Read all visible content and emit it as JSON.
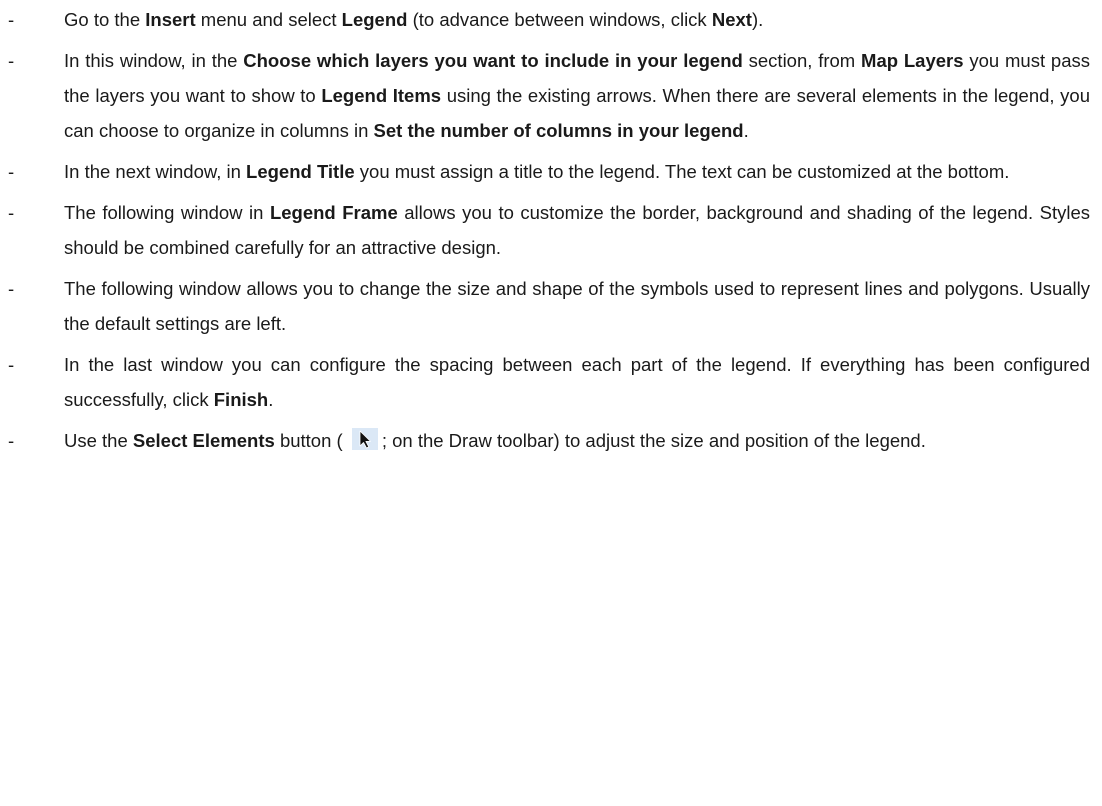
{
  "bullet_glyph": "-",
  "items": [
    {
      "segments": [
        {
          "text": "Go to the ",
          "bold": false
        },
        {
          "text": "Insert",
          "bold": true
        },
        {
          "text": " menu and select ",
          "bold": false
        },
        {
          "text": "Legend",
          "bold": true
        },
        {
          "text": " (to advance between windows, click ",
          "bold": false
        },
        {
          "text": "Next",
          "bold": true
        },
        {
          "text": ").",
          "bold": false
        }
      ]
    },
    {
      "segments": [
        {
          "text": "In this window, in the ",
          "bold": false
        },
        {
          "text": "Choose which layers you want to include in your legend",
          "bold": true
        },
        {
          "text": " section, from ",
          "bold": false
        },
        {
          "text": "Map Layers",
          "bold": true
        },
        {
          "text": " you must pass the layers you want to show to ",
          "bold": false
        },
        {
          "text": "Legend Items",
          "bold": true
        },
        {
          "text": " using the existing arrows. When there are several elements in the legend, you can choose to organize in columns in ",
          "bold": false
        },
        {
          "text": "Set the number of columns in your legend",
          "bold": true
        },
        {
          "text": ".",
          "bold": false
        }
      ]
    },
    {
      "segments": [
        {
          "text": "In the next window, in ",
          "bold": false
        },
        {
          "text": "Legend Title",
          "bold": true
        },
        {
          "text": " you must assign a title to the legend. The text can be customized at the bottom.",
          "bold": false
        }
      ]
    },
    {
      "segments": [
        {
          "text": "The following window in ",
          "bold": false
        },
        {
          "text": "Legend Frame",
          "bold": true
        },
        {
          "text": " allows you to customize the border, background and shading of the legend. Styles should be combined carefully for an attractive design.",
          "bold": false
        }
      ]
    },
    {
      "segments": [
        {
          "text": "The following window allows you to change the size and shape of the symbols used to represent lines and polygons. Usually the default settings are left.",
          "bold": false
        }
      ]
    },
    {
      "segments": [
        {
          "text": "In the last window you can configure the spacing between each part of the legend. If everything has been configured successfully, click ",
          "bold": false
        },
        {
          "text": "Finish",
          "bold": true
        },
        {
          "text": ".",
          "bold": false
        }
      ]
    },
    {
      "segments": [
        {
          "text": "Use the ",
          "bold": false
        },
        {
          "text": "Select Elements",
          "bold": true
        },
        {
          "text": " button ( ",
          "bold": false
        },
        {
          "icon": "select-elements-arrow-icon"
        },
        {
          "text": "; on the Draw toolbar) to adjust the size and position of the legend.",
          "bold": false
        }
      ]
    }
  ]
}
